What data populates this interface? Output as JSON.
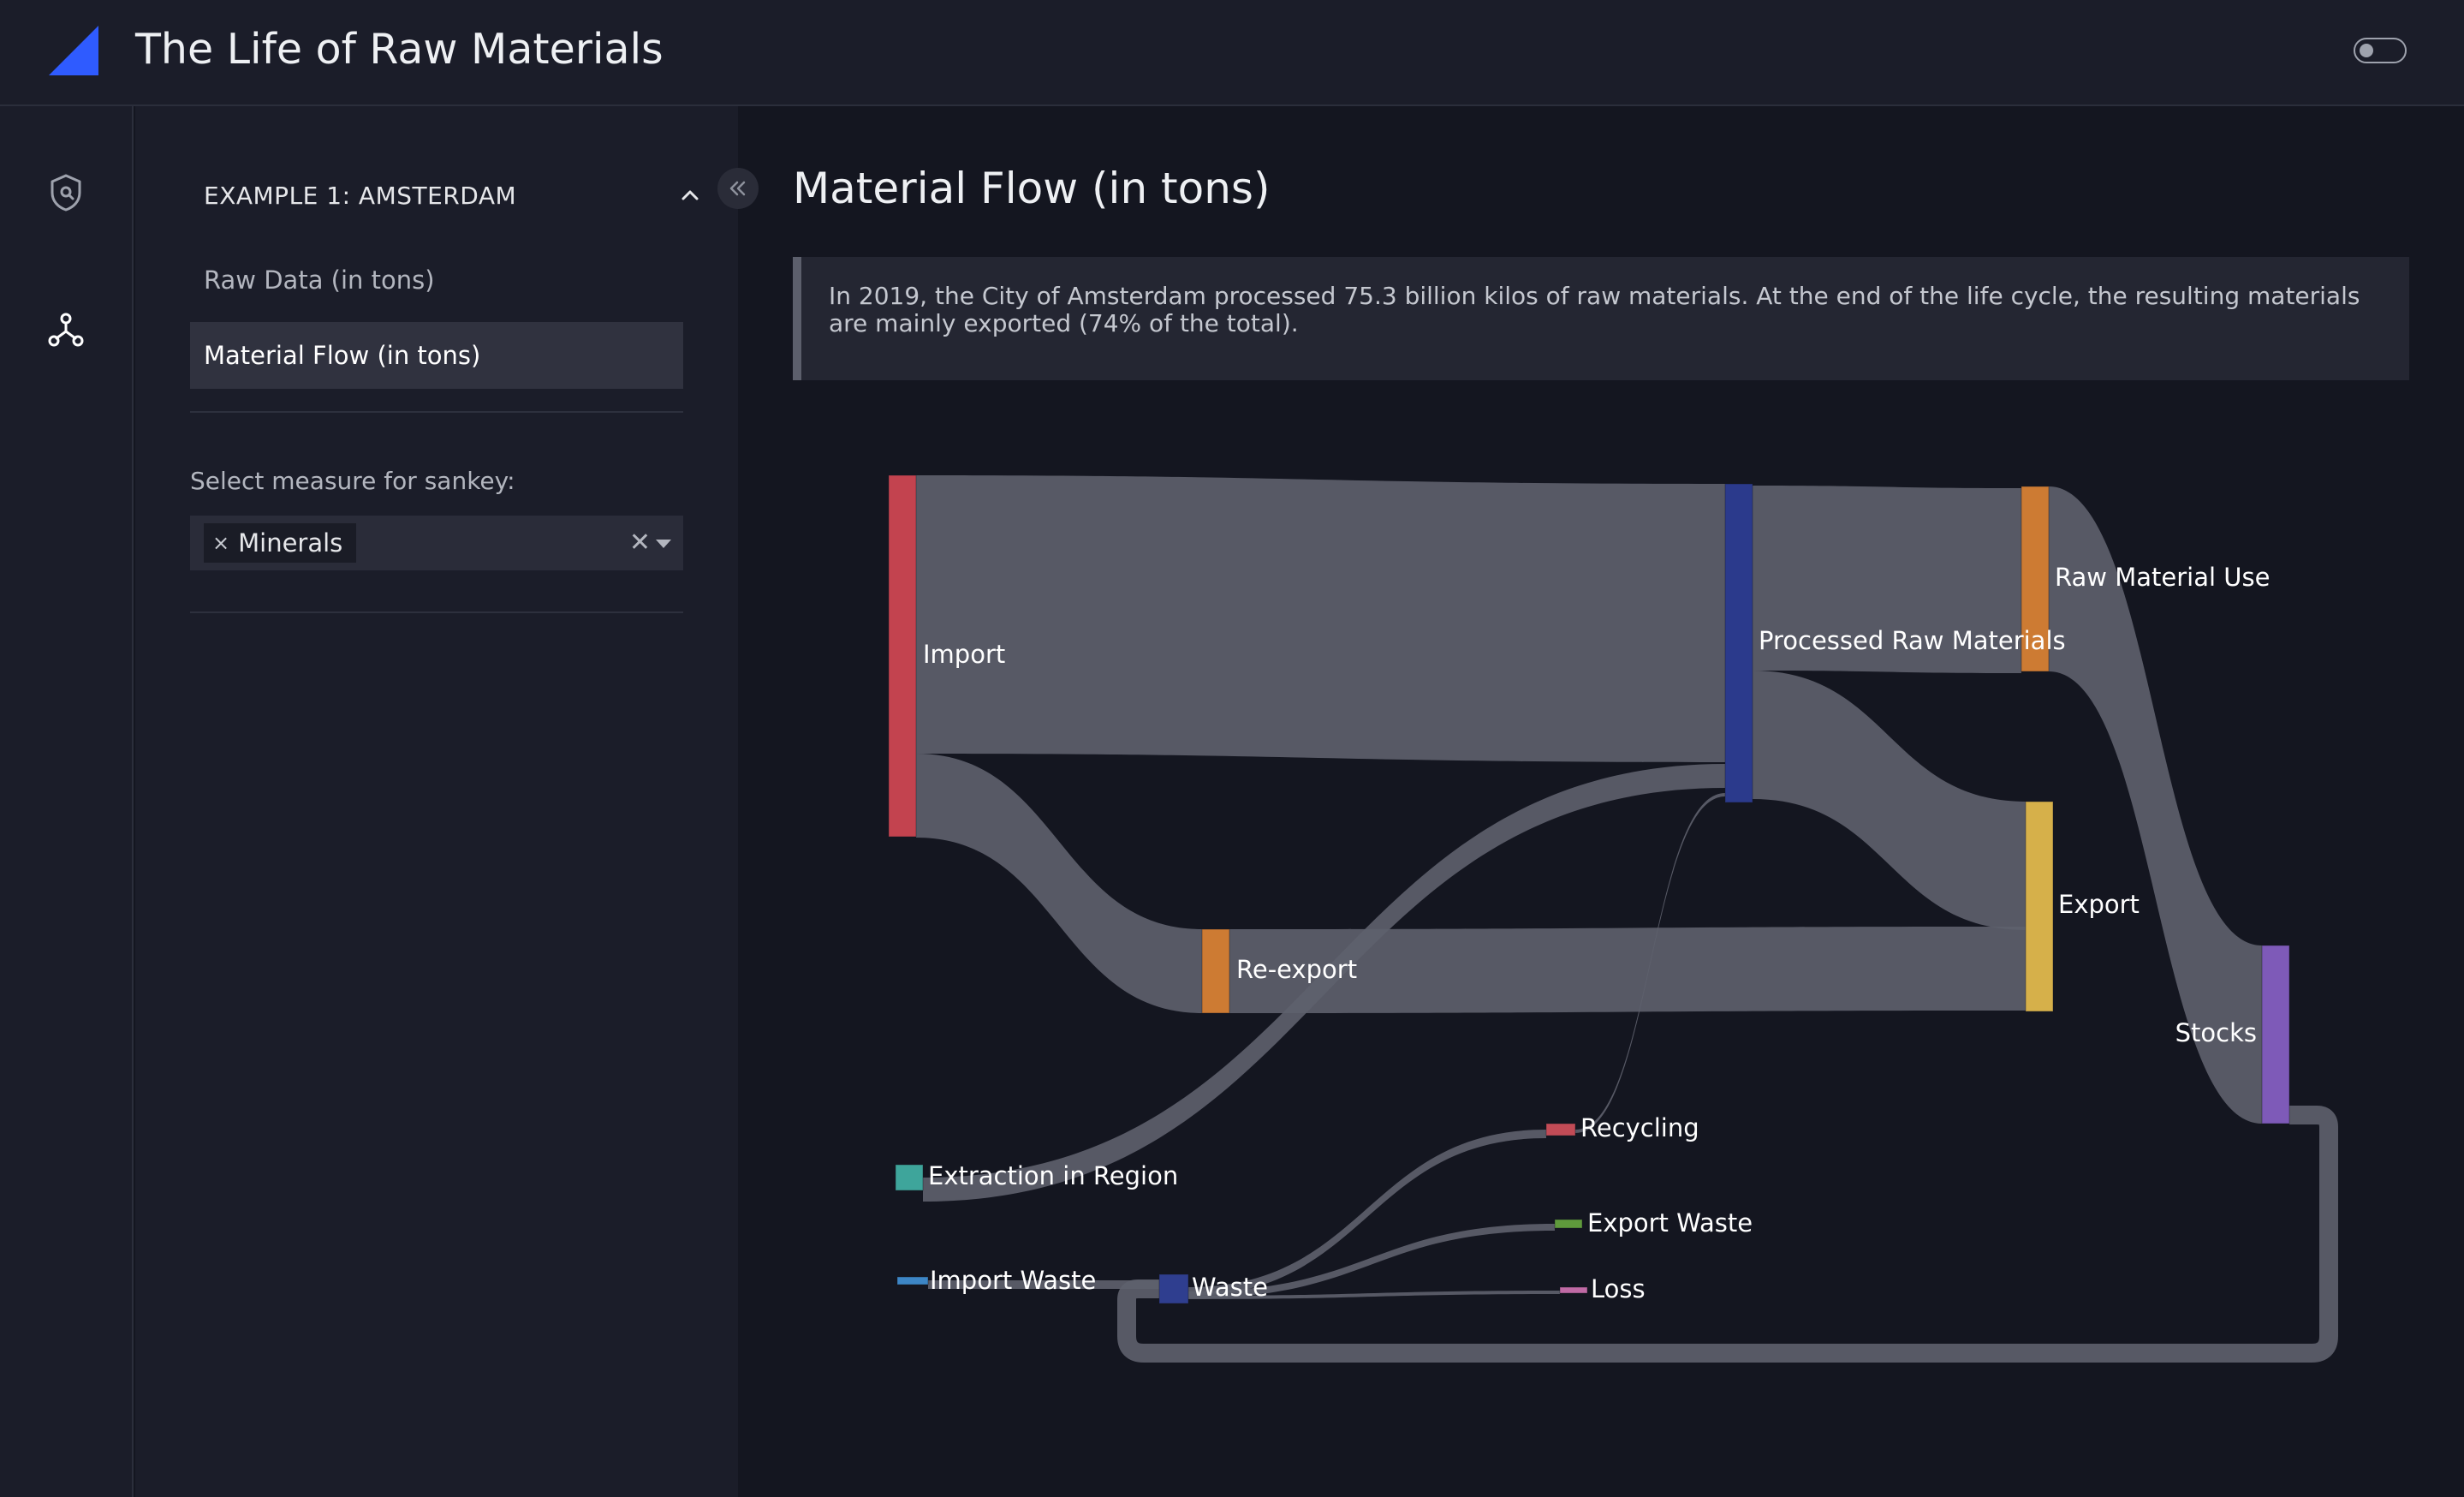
{
  "app": {
    "title": "The Life of Raw Materials",
    "icons": {
      "logo": "triangle-logo",
      "theme_toggle": "toggle-switch",
      "collapse": "double-chevron-left-icon"
    }
  },
  "nav": {
    "icons": [
      "shield-icon",
      "network-icon"
    ]
  },
  "sidebar": {
    "section_title": "EXAMPLE 1: AMSTERDAM",
    "items": [
      {
        "label": "Raw Data (in tons)",
        "active": false
      },
      {
        "label": "Material Flow (in tons)",
        "active": true
      }
    ],
    "measure_label": "Select measure for sankey:",
    "measure": {
      "chip_remove": "×",
      "value": "Minerals",
      "clear": "✕"
    }
  },
  "main": {
    "title": "Material Flow (in tons)",
    "description": "In 2019, the City of Amsterdam processed 75.3 billion kilos of raw materials. At the end of the life cycle, the resulting materials are mainly exported (74% of the total)."
  },
  "colors": {
    "link": "#5e606d",
    "import": "#c3434f",
    "processed": "#2b3a8c",
    "raw_use": "#cd7b33",
    "reexport": "#cd7b33",
    "export": "#d6b04a",
    "stocks": "#7e5ab8",
    "extraction": "#3ea59b",
    "import_waste": "#3d86c6",
    "waste": "#2f3e8f",
    "recycling": "#c24b56",
    "export_waste": "#5f9a3c",
    "loss": "#c06aa5",
    "accent": "#2f5bff"
  },
  "chart_data": {
    "type": "sankey",
    "nodes": [
      {
        "id": "import",
        "label": "Import"
      },
      {
        "id": "processed",
        "label": "Processed Raw Materials"
      },
      {
        "id": "raw_use",
        "label": "Raw Material Use"
      },
      {
        "id": "reexport",
        "label": "Re-export"
      },
      {
        "id": "export",
        "label": "Export"
      },
      {
        "id": "stocks",
        "label": "Stocks"
      },
      {
        "id": "recycling",
        "label": "Recycling"
      },
      {
        "id": "extraction",
        "label": "Extraction in Region"
      },
      {
        "id": "export_waste",
        "label": "Export Waste"
      },
      {
        "id": "import_waste",
        "label": "Import Waste"
      },
      {
        "id": "waste",
        "label": "Waste"
      },
      {
        "id": "loss",
        "label": "Loss"
      }
    ],
    "links": [
      {
        "source": "import",
        "target": "processed",
        "value": 32.5
      },
      {
        "source": "import",
        "target": "reexport",
        "value": 9.8
      },
      {
        "source": "extraction",
        "target": "processed",
        "value": 3.0
      },
      {
        "source": "recycling",
        "target": "processed",
        "value": 0.3
      },
      {
        "source": "processed",
        "target": "raw_use",
        "value": 21.5
      },
      {
        "source": "processed",
        "target": "export",
        "value": 15.0
      },
      {
        "source": "reexport",
        "target": "export",
        "value": 9.8
      },
      {
        "source": "raw_use",
        "target": "stocks",
        "value": 21.5
      },
      {
        "source": "stocks",
        "target": "waste",
        "value": 2.5
      },
      {
        "source": "import_waste",
        "target": "waste",
        "value": 1.0
      },
      {
        "source": "waste",
        "target": "recycling",
        "value": 1.5
      },
      {
        "source": "waste",
        "target": "export_waste",
        "value": 1.3
      },
      {
        "source": "waste",
        "target": "loss",
        "value": 0.6
      }
    ]
  }
}
